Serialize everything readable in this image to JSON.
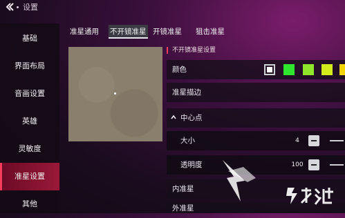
{
  "header": {
    "back_icon": "back-arrow-icon",
    "title": "设置"
  },
  "sidebar": {
    "items": [
      {
        "label": "基础"
      },
      {
        "label": "界面布局"
      },
      {
        "label": "音画设置"
      },
      {
        "label": "英雄"
      },
      {
        "label": "灵敏度"
      },
      {
        "label": "准星设置",
        "active": true
      },
      {
        "label": "其他"
      }
    ]
  },
  "tabs": [
    {
      "label": "准星通用"
    },
    {
      "label": "不开镜准星",
      "active": true
    },
    {
      "label": "开镜准星"
    },
    {
      "label": "狙击准星"
    }
  ],
  "settings": {
    "section_title": "不开镜准星设置",
    "color_label": "颜色",
    "colors": [
      "#ffffff",
      "#2ee62e",
      "#8fe62b",
      "#d4ec1c",
      "#f2d400"
    ],
    "selected_color": 0,
    "outline_label": "准星描边",
    "center_label": "中心点",
    "size_label": "大小",
    "size_value": "4",
    "opacity_label": "透明度",
    "opacity_value": "100",
    "inner_label": "内准星",
    "outer_label": "外准星"
  },
  "colors": {
    "accent": "#ff3b5c",
    "active_sidebar": "#9a1838",
    "background": "#1a0c1e"
  }
}
